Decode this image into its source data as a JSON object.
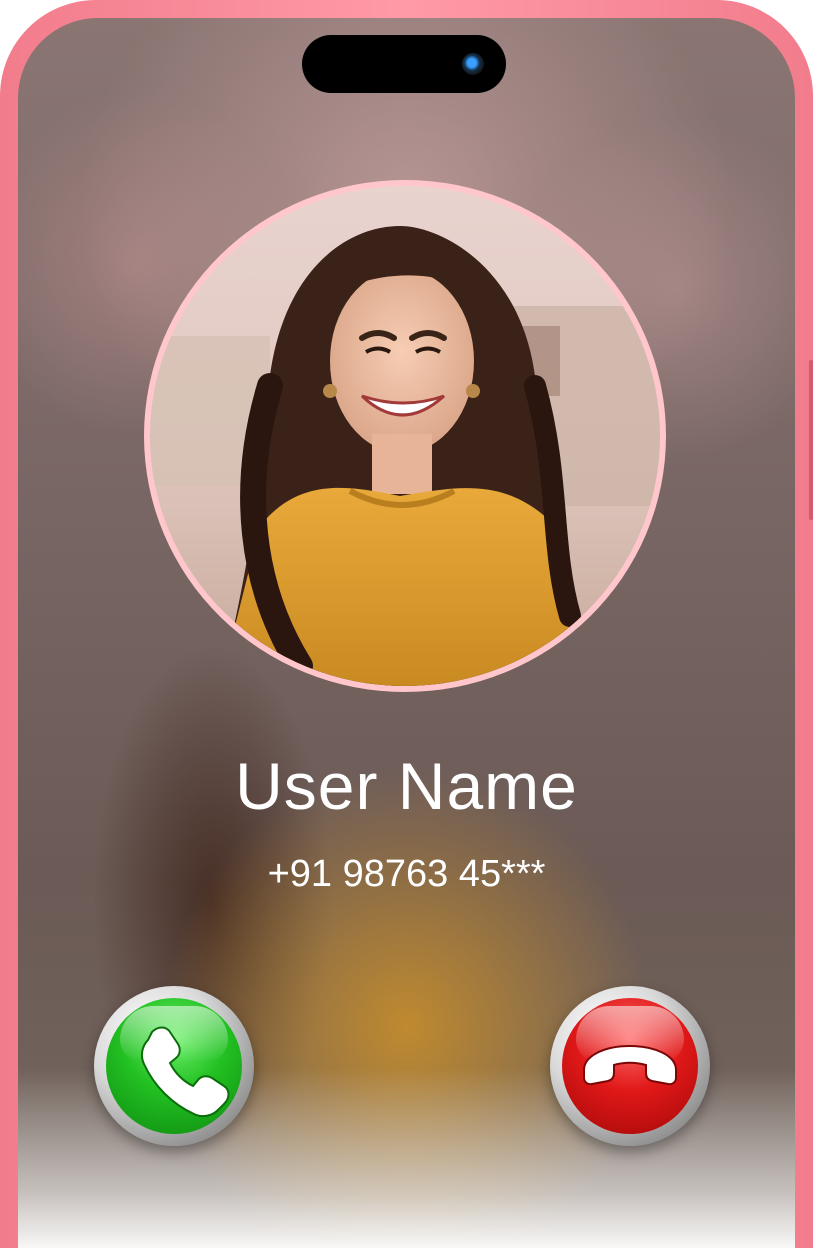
{
  "caller": {
    "name": "User Name",
    "phone": "+91 98763 45***"
  },
  "actions": {
    "accept_icon": "phone-accept-icon",
    "decline_icon": "phone-decline-icon"
  },
  "colors": {
    "frame": "#ff9aa6",
    "avatar_ring": "#ffc6cc",
    "accept": "#22c022",
    "decline": "#e01818",
    "text": "#ffffff"
  }
}
